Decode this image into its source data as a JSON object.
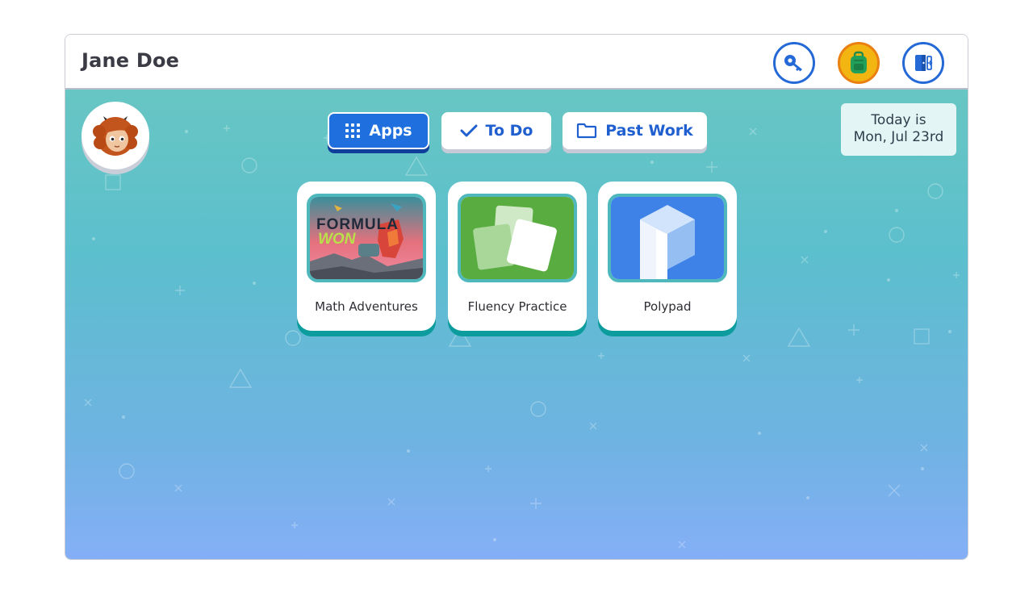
{
  "user": {
    "name": "Jane Doe"
  },
  "header_icons": [
    {
      "name": "key-icon"
    },
    {
      "name": "backpack-icon"
    },
    {
      "name": "exit-door-icon"
    }
  ],
  "tabs": [
    {
      "label": "Apps",
      "icon": "grid-icon",
      "active": true
    },
    {
      "label": "To Do",
      "icon": "checkmark-icon",
      "active": false
    },
    {
      "label": "Past Work",
      "icon": "folder-icon",
      "active": false
    }
  ],
  "date": {
    "line1": "Today is",
    "line2": "Mon, Jul 23rd"
  },
  "apps": [
    {
      "label": "Math Adventures",
      "thumb_title_1": "FORMULA",
      "thumb_title_2": "WON"
    },
    {
      "label": "Fluency Practice"
    },
    {
      "label": "Polypad"
    }
  ],
  "colors": {
    "accent_blue": "#1f6fdf",
    "card_shadow_teal": "#0d9c9e",
    "backpack_yellow": "#f2b512"
  }
}
